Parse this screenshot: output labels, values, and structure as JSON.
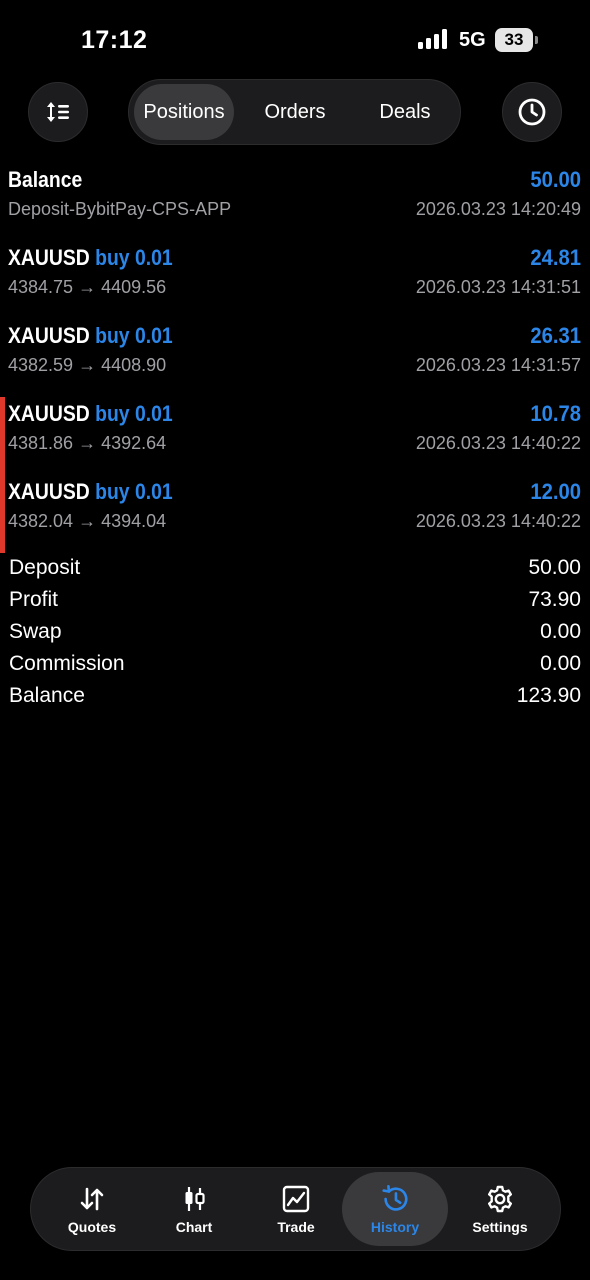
{
  "status_bar": {
    "time": "17:12",
    "network": "5G",
    "battery": "33"
  },
  "toolbar": {
    "sort_icon": "sort-list-icon",
    "history_period_icon": "clock-icon",
    "tabs": [
      {
        "label": "Positions",
        "active": true
      },
      {
        "label": "Orders",
        "active": false
      },
      {
        "label": "Deals",
        "active": false
      }
    ]
  },
  "deals": [
    {
      "symbol": "Balance",
      "side": "",
      "amount": "50.00",
      "detail": "Deposit-BybitPay-CPS-APP",
      "time": "2026.03.23 14:20:49",
      "marked": false
    },
    {
      "symbol": "XAUUSD",
      "side": "buy 0.01",
      "amount": "24.81",
      "detail": "4384.75 → 4409.56",
      "time": "2026.03.23 14:31:51",
      "marked": false
    },
    {
      "symbol": "XAUUSD",
      "side": "buy 0.01",
      "amount": "26.31",
      "detail": "4382.59 → 4408.90",
      "time": "2026.03.23 14:31:57",
      "marked": false
    },
    {
      "symbol": "XAUUSD",
      "side": "buy 0.01",
      "amount": "10.78",
      "detail": "4381.86 → 4392.64",
      "time": "2026.03.23 14:40:22",
      "marked": true
    },
    {
      "symbol": "XAUUSD",
      "side": "buy 0.01",
      "amount": "12.00",
      "detail": "4382.04 → 4394.04",
      "time": "2026.03.23 14:40:22",
      "marked": true
    }
  ],
  "summary": [
    {
      "label": "Deposit",
      "value": "50.00"
    },
    {
      "label": "Profit",
      "value": "73.90"
    },
    {
      "label": "Swap",
      "value": "0.00"
    },
    {
      "label": "Commission",
      "value": "0.00"
    },
    {
      "label": "Balance",
      "value": "123.90"
    }
  ],
  "nav": [
    {
      "label": "Quotes",
      "icon": "quotes-arrows-icon",
      "active": false
    },
    {
      "label": "Chart",
      "icon": "candlestick-icon",
      "active": false
    },
    {
      "label": "Trade",
      "icon": "trade-chart-icon",
      "active": false
    },
    {
      "label": "History",
      "icon": "history-icon",
      "active": true
    },
    {
      "label": "Settings",
      "icon": "gear-icon",
      "active": false
    }
  ],
  "colors": {
    "accent": "#2b86e8",
    "background": "#000000",
    "marker": "#e0392b",
    "muted_text": "#a0a0a5"
  }
}
